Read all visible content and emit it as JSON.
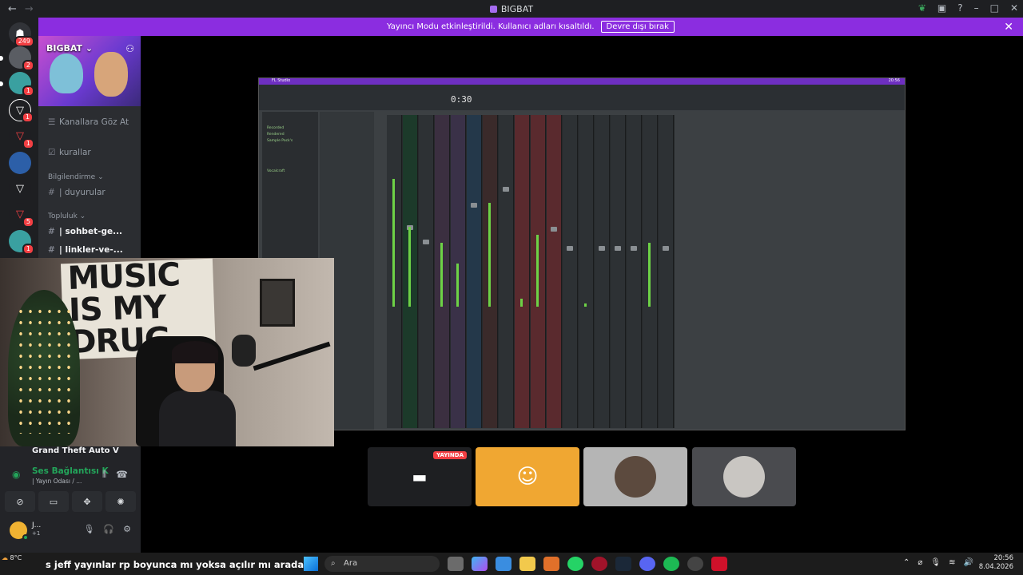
{
  "window": {
    "title": "BIGBAT"
  },
  "banner": {
    "message": "Yayıncı Modu etkinleştirildi. Kullanıcı adları kısaltıldı.",
    "disable_button": "Devre dışı bırak"
  },
  "rail": {
    "home_badge": "249",
    "items": [
      {
        "badge": "2"
      },
      {
        "badge": "1"
      },
      {
        "badge": "1"
      },
      {
        "badge": "1"
      },
      {
        "badge": ""
      },
      {
        "badge": ""
      },
      {
        "badge": "5"
      },
      {
        "badge": "1"
      }
    ]
  },
  "server": {
    "name": "BIGBAT",
    "channels": {
      "browse": "Kanallara Göz At",
      "rules": "kurallar",
      "category_info": "Bilgilendirme",
      "announcements": "| duyurular",
      "category_community": "Topluluk",
      "chat": "| sohbet-ge...",
      "links": "| linkler-ve-..."
    }
  },
  "screen_share": {
    "tempo_display": "0:30",
    "menu_label": "FL Studio",
    "clock": "20:56",
    "browser_items": [
      "Recorded",
      "Rendered",
      "Sample Pack's",
      "Vocalcraft"
    ]
  },
  "voice": {
    "game": "Grand Theft Auto V",
    "status": "Ses Bağlantısı K",
    "channel": "| Yayın Odası / ...",
    "user_name": "J...",
    "user_status": "+1"
  },
  "tiles": {
    "live_label": "YAYINDA"
  },
  "taskbar": {
    "temperature": "8°C",
    "ticker": "jeff yayınlar rp boyunca mı yoksa açılır mı arada",
    "ticker_prefix": "s",
    "search_placeholder": "Ara",
    "time": "20:56",
    "date": "8.04.2026"
  },
  "colors": {
    "accent": "#8b2de0",
    "online": "#23a55a",
    "live": "#f23f43",
    "discord_tile": "#f0a732"
  }
}
